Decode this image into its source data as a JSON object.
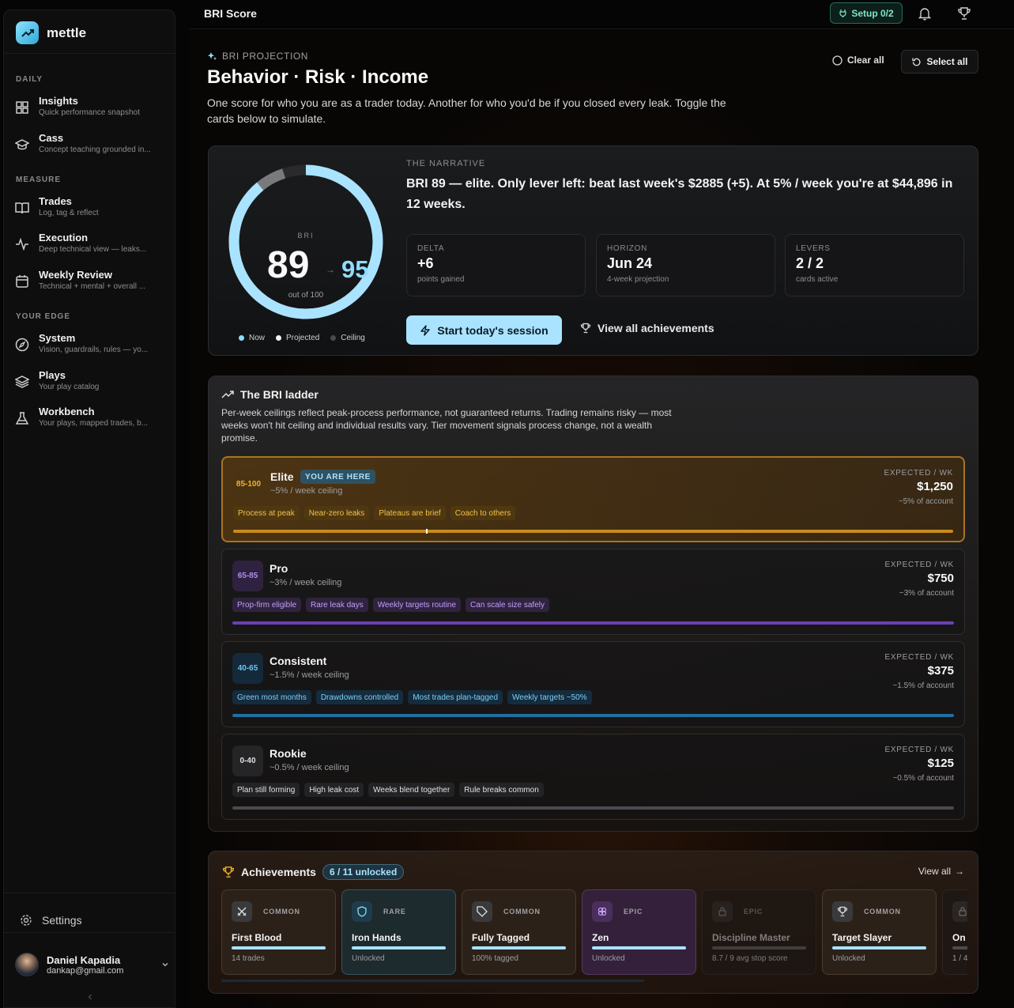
{
  "sidebar": {
    "app_name": "mettle",
    "sections": [
      {
        "label": "DAILY"
      },
      {
        "label": "MEASURE"
      },
      {
        "label": "YOUR EDGE"
      }
    ],
    "items": [
      {
        "title": "Insights",
        "subtitle": "Quick performance snapshot",
        "icon": "grid-icon"
      },
      {
        "title": "Cass",
        "subtitle": "Concept teaching grounded in...",
        "icon": "graduation-cap-icon"
      },
      {
        "title": "Trades",
        "subtitle": "Log, tag & reflect",
        "icon": "book-icon"
      },
      {
        "title": "Execution",
        "subtitle": "Deep technical view — leaks...",
        "icon": "pulse-icon"
      },
      {
        "title": "Weekly Review",
        "subtitle": "Technical + mental + overall ...",
        "icon": "calendar-icon"
      },
      {
        "title": "System",
        "subtitle": "Vision, guardrails, rules — yo...",
        "icon": "compass-icon"
      },
      {
        "title": "Plays",
        "subtitle": "Your play catalog",
        "icon": "layers-icon"
      },
      {
        "title": "Workbench",
        "subtitle": "Your plays, mapped trades, b...",
        "icon": "flask-icon"
      }
    ],
    "settings_label": "Settings",
    "user": {
      "name": "Daniel Kapadia",
      "email": "dankap@gmail.com"
    }
  },
  "topbar": {
    "title": "BRI Score",
    "setup_label": "Setup 0/2"
  },
  "header": {
    "eyebrow": "BRI PROJECTION",
    "title": "Behavior · Risk · Income",
    "lead": "One score for who you are as a trader today. Another for who you'd be if you closed every leak. Toggle the cards below to simulate.",
    "clear_all": "Clear all",
    "select_all": "Select all"
  },
  "hero": {
    "gauge_label": "BRI",
    "now": 89,
    "projected": 95,
    "out_of": "out of 100",
    "ceiling": 100,
    "legend": [
      "Now",
      "Projected",
      "Ceiling"
    ],
    "narrative_label": "THE NARRATIVE",
    "narrative": "BRI 89 — elite. Only lever left: beat last week's $2885 (+5). At 5% / week you're at $44,896 in 12 weeks.",
    "stats": [
      {
        "label": "DELTA",
        "value": "+6",
        "sub": "points gained"
      },
      {
        "label": "HORIZON",
        "value": "Jun 24",
        "sub": "4-week projection"
      },
      {
        "label": "LEVERS",
        "value": "2 / 2",
        "sub": "cards active"
      }
    ],
    "start_label": "Start today's session",
    "achievements_link": "View all achievements"
  },
  "ladder": {
    "title": "The BRI ladder",
    "description": "Per-week ceilings reflect peak-process performance, not guaranteed returns. Trading remains risky — most weeks won't hit ceiling and individual results vary. Tier movement signals process change, not a wealth promise.",
    "expected_label": "EXPECTED / WK",
    "here_label": "YOU ARE HERE",
    "tiers": [
      {
        "range": "85-100",
        "name": "Elite",
        "ceiling": "~5% / week ceiling",
        "tags": [
          "Process at peak",
          "Near-zero leaks",
          "Plateaus are brief",
          "Coach to others"
        ],
        "expected": "$1,250",
        "pct": "~5% of account",
        "color": "#c98a1e",
        "badge_color": "#f0b429",
        "marker": 0.268
      },
      {
        "range": "65-85",
        "name": "Pro",
        "ceiling": "~3% / week ceiling",
        "tags": [
          "Prop-firm eligible",
          "Rare leak days",
          "Weekly targets routine",
          "Can scale size safely"
        ],
        "expected": "$750",
        "pct": "~3% of account",
        "color": "#6b3fb5",
        "badge_color": "#b18cf0"
      },
      {
        "range": "40-65",
        "name": "Consistent",
        "ceiling": "~1.5% / week ceiling",
        "tags": [
          "Green most months",
          "Drawdowns controlled",
          "Most trades plan-tagged",
          "Weekly targets ~50%"
        ],
        "expected": "$375",
        "pct": "~1.5% of account",
        "color": "#1f6f9f",
        "badge_color": "#6cc3f0"
      },
      {
        "range": "0-40",
        "name": "Rookie",
        "ceiling": "~0.5% / week ceiling",
        "tags": [
          "Plan still forming",
          "High leak cost",
          "Weeks blend together",
          "Rule breaks common"
        ],
        "expected": "$125",
        "pct": "~0.5% of account",
        "color": "#4a4a4e",
        "badge_color": "#d0d0d3"
      }
    ]
  },
  "achievements": {
    "title": "Achievements",
    "unlocked": "6 / 11 unlocked",
    "view_all": "View all",
    "cards": [
      {
        "rarity": "COMMON",
        "name": "First Blood",
        "sub": "14 trades",
        "icon": "swords-icon",
        "locked": false
      },
      {
        "rarity": "RARE",
        "name": "Iron Hands",
        "sub": "Unlocked",
        "icon": "shield-icon",
        "locked": false
      },
      {
        "rarity": "COMMON",
        "name": "Fully Tagged",
        "sub": "100% tagged",
        "icon": "tag-icon",
        "locked": false
      },
      {
        "rarity": "EPIC",
        "name": "Zen",
        "sub": "Unlocked",
        "icon": "lotus-icon",
        "locked": false
      },
      {
        "rarity": "EPIC",
        "name": "Discipline Master",
        "sub": "8.7 / 9 avg stop score",
        "icon": "lock-icon",
        "locked": true
      },
      {
        "rarity": "COMMON",
        "name": "Target Slayer",
        "sub": "Unlocked",
        "icon": "trophy-icon",
        "locked": false
      },
      {
        "rarity": "",
        "name": "On",
        "sub": "1 / 4",
        "icon": "lock-icon",
        "locked": true
      }
    ]
  }
}
